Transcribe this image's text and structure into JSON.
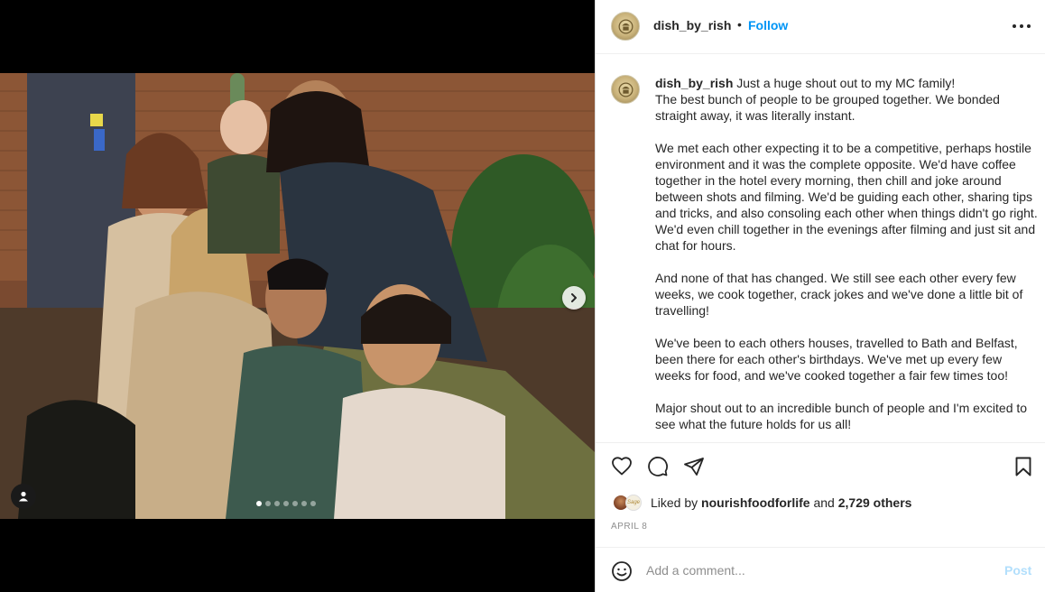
{
  "post": {
    "username": "dish_by_rish",
    "separator": "•",
    "follow_label": "Follow",
    "more_icon": "more-horizontal-icon"
  },
  "media": {
    "photo_description_icon": "group-selfie-photo",
    "next_icon": "chevron-right-icon",
    "tag_icon": "user-tag-icon",
    "carousel": {
      "count": 7,
      "active": 0
    }
  },
  "caption": {
    "username": "dish_by_rish",
    "first_line": "Just a huge shout out to my MC family!",
    "paragraphs": [
      "The best bunch of people to be grouped together. We bonded straight away, it was literally instant.",
      "We met each other expecting it to be a competitive, perhaps hostile environment and it was the complete opposite. We'd have coffee together in the hotel every morning, then chill and joke around between shots and filming. We'd be guiding each other, sharing tips and tricks, and also consoling each other when things didn't go right. We'd even chill together in the evenings after filming and just sit and chat for hours.",
      "And none of that has changed. We still see each other every few weeks, we cook together, crack jokes and we've done a little bit of travelling!",
      "We've been to each others houses, travelled to Bath and Belfast, been there for each other's birthdays. We've met up every few weeks for food, and we've cooked together a fair few times too!",
      "Major shout out to an incredible bunch of people and I'm excited to see what the future holds for us all!"
    ]
  },
  "actions": {
    "like_icon": "heart-icon",
    "comment_icon": "comment-icon",
    "share_icon": "send-icon",
    "save_icon": "bookmark-icon"
  },
  "likes": {
    "prefix": "Liked by",
    "user": "nourishfoodforlife",
    "conj": "and",
    "others": "2,729 others",
    "avatar2_text": "Sage"
  },
  "date": "APRIL 8",
  "comment": {
    "placeholder": "Add a comment...",
    "post_label": "Post",
    "emoji_icon": "smiley-icon"
  },
  "colors": {
    "link_blue": "#0095f6",
    "post_disabled": "#b2dffc",
    "text": "#262626",
    "muted": "#8e8e8e"
  }
}
